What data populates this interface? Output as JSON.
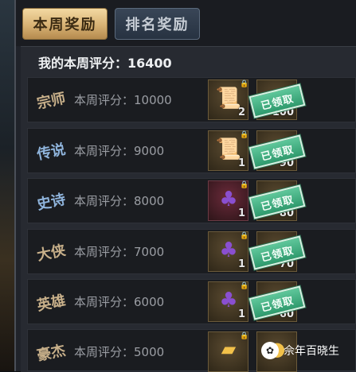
{
  "tabs": {
    "weekly": "本周奖励",
    "ranking": "排名奖励"
  },
  "summary": {
    "label": "我的本周评分：",
    "score": "16400"
  },
  "claimed_label": "已领取",
  "rows": [
    {
      "rank_mark": "宗师",
      "label": "本周评分：10000",
      "item1_count": "2",
      "item2_count": "100",
      "item1_icon": "scroll-icon",
      "item2_icon": "coin-icon",
      "item1_kind": "scroll"
    },
    {
      "rank_mark": "传说",
      "label": "本周评分：9000",
      "item1_count": "1",
      "item2_count": "90",
      "item1_icon": "scroll-icon",
      "item2_icon": "coin-icon",
      "item1_kind": "scroll"
    },
    {
      "rank_mark": "史诗",
      "label": "本周评分：8000",
      "item1_count": "1",
      "item2_count": "80",
      "item1_icon": "pouch-icon",
      "item2_icon": "coin-icon",
      "item1_kind": "pouch"
    },
    {
      "rank_mark": "大侠",
      "label": "本周评分：7000",
      "item1_count": "1",
      "item2_count": "70",
      "item1_icon": "pouch-icon",
      "item2_icon": "coin-icon",
      "item1_kind": "pouch"
    },
    {
      "rank_mark": "英雄",
      "label": "本周评分：6000",
      "item1_count": "1",
      "item2_count": "60",
      "item1_icon": "pouch-icon",
      "item2_icon": "coin-icon",
      "item1_kind": "pouch"
    },
    {
      "rank_mark": "豪杰",
      "label": "本周评分：5000",
      "item1_count": "",
      "item2_count": "",
      "item1_icon": "gold-ingot-icon",
      "item2_icon": "coin-icon",
      "item1_kind": "gold"
    }
  ],
  "watermark": "佘年百晓生"
}
